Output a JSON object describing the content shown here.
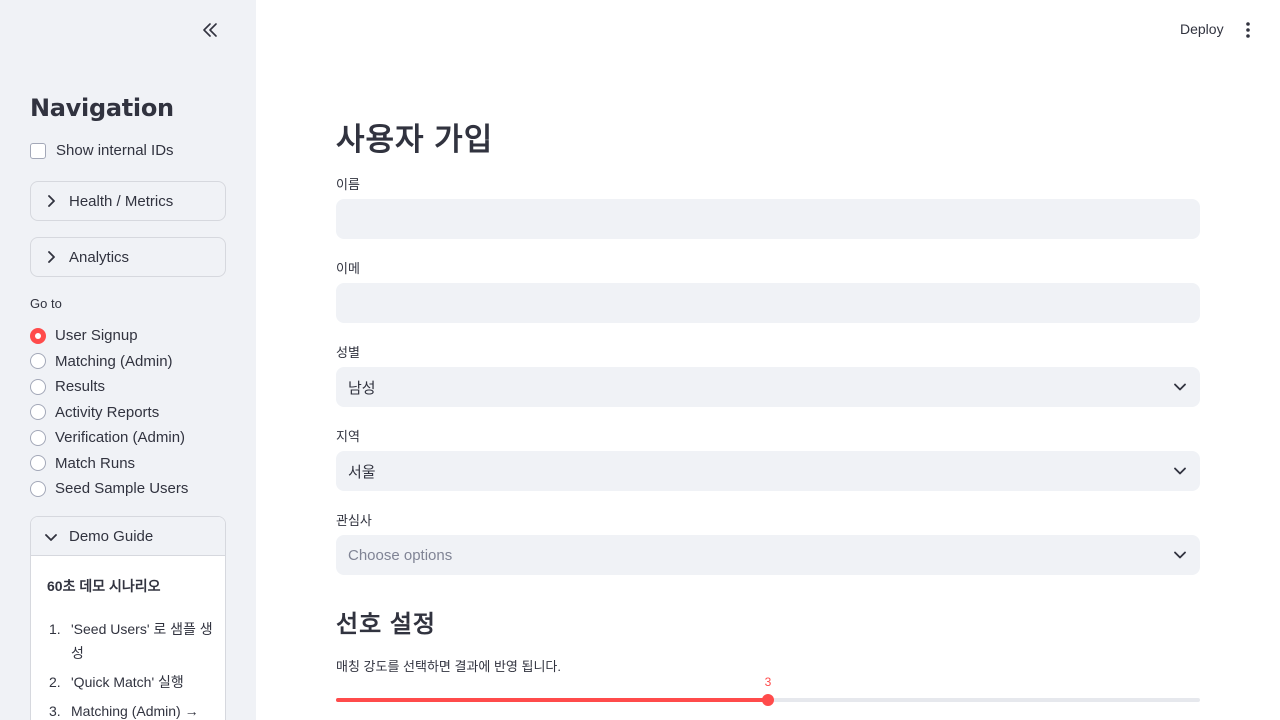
{
  "colors": {
    "accent": "#ff4b4b",
    "sidebar_bg": "#f0f2f6",
    "input_bg": "#f0f2f6"
  },
  "sidebar": {
    "collapse_icon": "double-chevron-left-icon",
    "title": "Navigation",
    "show_ids_label": "Show internal IDs",
    "expanders": [
      {
        "label": "Health / Metrics"
      },
      {
        "label": "Analytics"
      }
    ],
    "goto_label": "Go to",
    "pages": [
      {
        "label": "User Signup",
        "selected": true
      },
      {
        "label": "Matching (Admin)",
        "selected": false
      },
      {
        "label": "Results",
        "selected": false
      },
      {
        "label": "Activity Reports",
        "selected": false
      },
      {
        "label": "Verification (Admin)",
        "selected": false
      },
      {
        "label": "Match Runs",
        "selected": false
      },
      {
        "label": "Seed Sample Users",
        "selected": false
      }
    ],
    "demo_guide": {
      "label": "Demo Guide",
      "subtitle": "60초 데모 시나리오",
      "steps": [
        {
          "num": "1.",
          "text": "'Seed Users' 로 샘플 생성"
        },
        {
          "num": "2.",
          "text": "'Quick Match' 실행"
        },
        {
          "num": "3.",
          "text": "Matching (Admin) →"
        }
      ]
    }
  },
  "header": {
    "deploy_label": "Deploy",
    "menu_icon": "vertical-ellipsis-icon"
  },
  "main": {
    "title": "사용자 가입",
    "fields": [
      {
        "label": "이름",
        "value": ""
      },
      {
        "label": "이메",
        "value": ""
      }
    ],
    "selects": [
      {
        "label": "성별",
        "value": "남성"
      },
      {
        "label": "지역",
        "value": "서울"
      }
    ],
    "multiselect": {
      "label": "관심사",
      "placeholder": "Choose options"
    },
    "section_title": "선호 설정",
    "helper_text": "매칭 강도를 선택하면 결과에 반영 됩니다.",
    "slider": {
      "value": "3",
      "fraction": 0.5
    }
  }
}
